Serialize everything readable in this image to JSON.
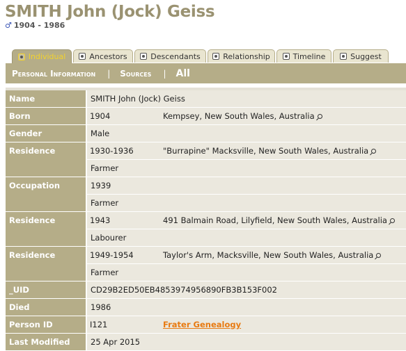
{
  "person": {
    "name": "SMITH John (Jock) Geiss",
    "gender_symbol": "♂",
    "lifespan": "1904 - 1986"
  },
  "tabs": [
    {
      "label": "Individual",
      "icon": "individual-icon",
      "active": true
    },
    {
      "label": "Ancestors",
      "icon": "ancestors-icon",
      "active": false
    },
    {
      "label": "Descendants",
      "icon": "descendants-icon",
      "active": false
    },
    {
      "label": "Relationship",
      "icon": "relationship-icon",
      "active": false
    },
    {
      "label": "Timeline",
      "icon": "timeline-icon",
      "active": false
    },
    {
      "label": "Suggest",
      "icon": "suggest-icon",
      "active": false
    }
  ],
  "subnav": {
    "personal_information": "Personal Information",
    "sep1": "|",
    "sources": "Sources",
    "sep2": "|",
    "all": "All"
  },
  "facts": {
    "name": {
      "label": "Name",
      "value": "SMITH John (Jock) Geiss"
    },
    "born": {
      "label": "Born",
      "date": "1904",
      "place": "Kempsey, New South Wales, Australia"
    },
    "gender": {
      "label": "Gender",
      "value": "Male"
    },
    "residence1": {
      "label": "Residence",
      "date": "1930-1936",
      "place": "\"Burrapine\" Macksville, New South Wales, Australia",
      "note": "Farmer"
    },
    "occupation": {
      "label": "Occupation",
      "date": "1939",
      "note": "Farmer"
    },
    "residence2": {
      "label": "Residence",
      "date": "1943",
      "place": "491 Balmain Road, Lilyfield, New South Wales, Australia",
      "note": "Labourer"
    },
    "residence3": {
      "label": "Residence",
      "date": "1949-1954",
      "place": "Taylor's Arm, Macksville, New South Wales, Australia",
      "note": "Farmer"
    },
    "uid": {
      "label": "_UID",
      "value": "CD29B2ED50EB4853974956890FB3B153F002"
    },
    "died": {
      "label": "Died",
      "value": "1986"
    },
    "person_id": {
      "label": "Person ID",
      "value": "I121",
      "tree": "Frater Genealogy"
    },
    "last_modified": {
      "label": "Last Modified",
      "value": "25 Apr 2015"
    }
  },
  "colors": {
    "title": "#9a9271",
    "header_band": "#b5ad88",
    "value_bg": "#ebe8de",
    "active_tab_text": "#f2d22e",
    "link": "#e87b12"
  }
}
